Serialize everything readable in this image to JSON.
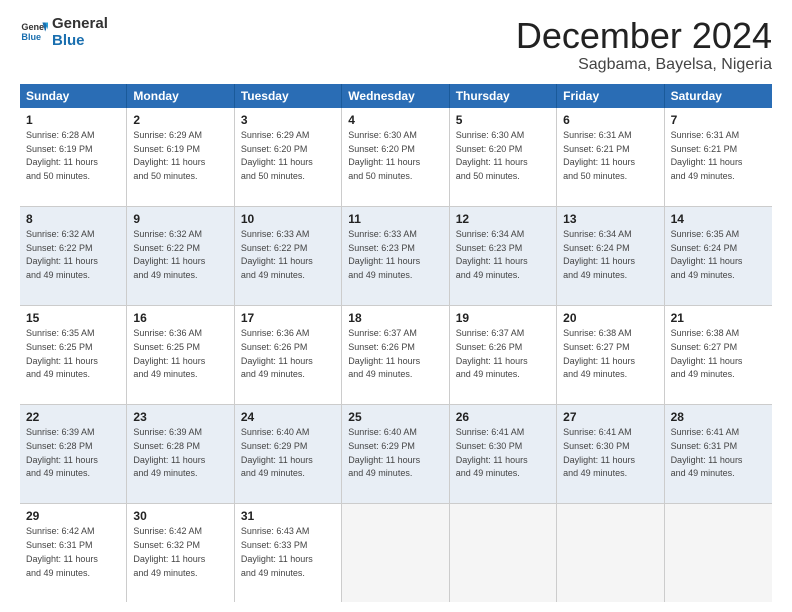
{
  "logo": {
    "line1": "General",
    "line2": "Blue"
  },
  "title": "December 2024",
  "subtitle": "Sagbama, Bayelsa, Nigeria",
  "days_of_week": [
    "Sunday",
    "Monday",
    "Tuesday",
    "Wednesday",
    "Thursday",
    "Friday",
    "Saturday"
  ],
  "weeks": [
    [
      {
        "num": "1",
        "rise": "6:28 AM",
        "set": "6:19 PM",
        "hours": "11",
        "mins": "50"
      },
      {
        "num": "2",
        "rise": "6:29 AM",
        "set": "6:19 PM",
        "hours": "11",
        "mins": "50"
      },
      {
        "num": "3",
        "rise": "6:29 AM",
        "set": "6:20 PM",
        "hours": "11",
        "mins": "50"
      },
      {
        "num": "4",
        "rise": "6:30 AM",
        "set": "6:20 PM",
        "hours": "11",
        "mins": "50"
      },
      {
        "num": "5",
        "rise": "6:30 AM",
        "set": "6:20 PM",
        "hours": "11",
        "mins": "50"
      },
      {
        "num": "6",
        "rise": "6:31 AM",
        "set": "6:21 PM",
        "hours": "11",
        "mins": "50"
      },
      {
        "num": "7",
        "rise": "6:31 AM",
        "set": "6:21 PM",
        "hours": "11",
        "mins": "49"
      }
    ],
    [
      {
        "num": "8",
        "rise": "6:32 AM",
        "set": "6:22 PM",
        "hours": "11",
        "mins": "49"
      },
      {
        "num": "9",
        "rise": "6:32 AM",
        "set": "6:22 PM",
        "hours": "11",
        "mins": "49"
      },
      {
        "num": "10",
        "rise": "6:33 AM",
        "set": "6:22 PM",
        "hours": "11",
        "mins": "49"
      },
      {
        "num": "11",
        "rise": "6:33 AM",
        "set": "6:23 PM",
        "hours": "11",
        "mins": "49"
      },
      {
        "num": "12",
        "rise": "6:34 AM",
        "set": "6:23 PM",
        "hours": "11",
        "mins": "49"
      },
      {
        "num": "13",
        "rise": "6:34 AM",
        "set": "6:24 PM",
        "hours": "11",
        "mins": "49"
      },
      {
        "num": "14",
        "rise": "6:35 AM",
        "set": "6:24 PM",
        "hours": "11",
        "mins": "49"
      }
    ],
    [
      {
        "num": "15",
        "rise": "6:35 AM",
        "set": "6:25 PM",
        "hours": "11",
        "mins": "49"
      },
      {
        "num": "16",
        "rise": "6:36 AM",
        "set": "6:25 PM",
        "hours": "11",
        "mins": "49"
      },
      {
        "num": "17",
        "rise": "6:36 AM",
        "set": "6:26 PM",
        "hours": "11",
        "mins": "49"
      },
      {
        "num": "18",
        "rise": "6:37 AM",
        "set": "6:26 PM",
        "hours": "11",
        "mins": "49"
      },
      {
        "num": "19",
        "rise": "6:37 AM",
        "set": "6:26 PM",
        "hours": "11",
        "mins": "49"
      },
      {
        "num": "20",
        "rise": "6:38 AM",
        "set": "6:27 PM",
        "hours": "11",
        "mins": "49"
      },
      {
        "num": "21",
        "rise": "6:38 AM",
        "set": "6:27 PM",
        "hours": "11",
        "mins": "49"
      }
    ],
    [
      {
        "num": "22",
        "rise": "6:39 AM",
        "set": "6:28 PM",
        "hours": "11",
        "mins": "49"
      },
      {
        "num": "23",
        "rise": "6:39 AM",
        "set": "6:28 PM",
        "hours": "11",
        "mins": "49"
      },
      {
        "num": "24",
        "rise": "6:40 AM",
        "set": "6:29 PM",
        "hours": "11",
        "mins": "49"
      },
      {
        "num": "25",
        "rise": "6:40 AM",
        "set": "6:29 PM",
        "hours": "11",
        "mins": "49"
      },
      {
        "num": "26",
        "rise": "6:41 AM",
        "set": "6:30 PM",
        "hours": "11",
        "mins": "49"
      },
      {
        "num": "27",
        "rise": "6:41 AM",
        "set": "6:30 PM",
        "hours": "11",
        "mins": "49"
      },
      {
        "num": "28",
        "rise": "6:41 AM",
        "set": "6:31 PM",
        "hours": "11",
        "mins": "49"
      }
    ],
    [
      {
        "num": "29",
        "rise": "6:42 AM",
        "set": "6:31 PM",
        "hours": "11",
        "mins": "49"
      },
      {
        "num": "30",
        "rise": "6:42 AM",
        "set": "6:32 PM",
        "hours": "11",
        "mins": "49"
      },
      {
        "num": "31",
        "rise": "6:43 AM",
        "set": "6:33 PM",
        "hours": "11",
        "mins": "49"
      },
      null,
      null,
      null,
      null
    ]
  ]
}
